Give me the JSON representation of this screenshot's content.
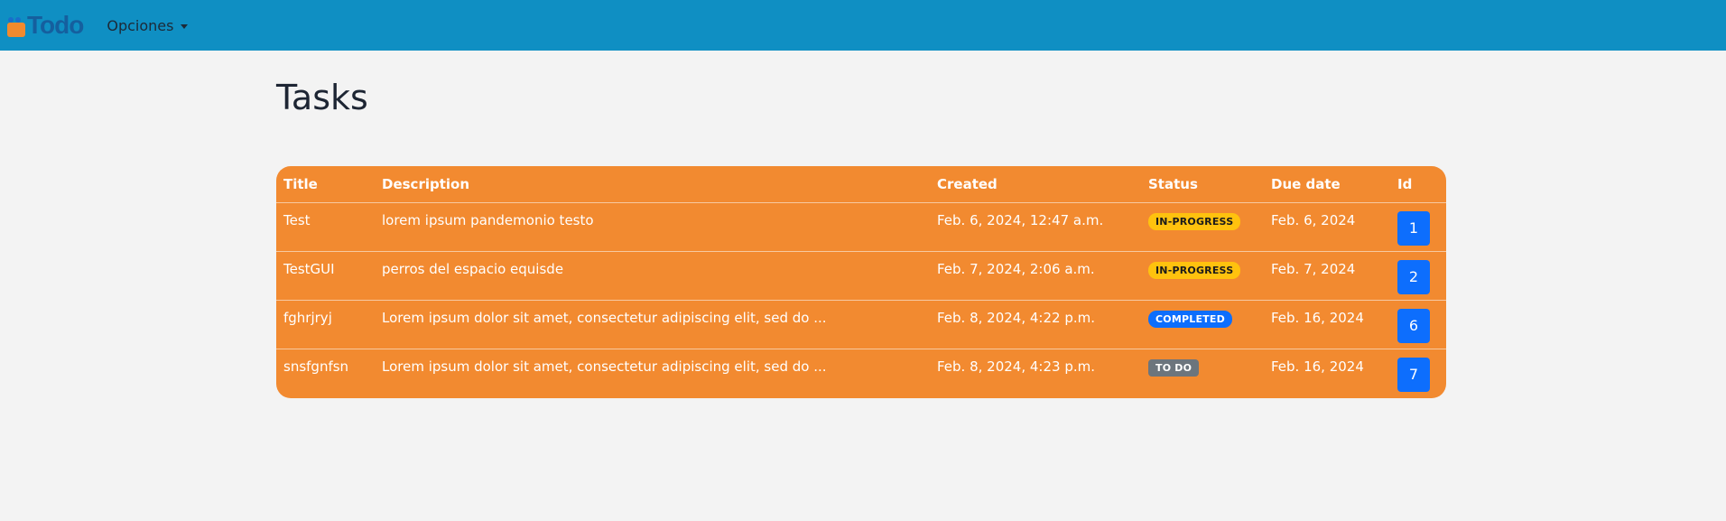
{
  "nav": {
    "brand": "Todo",
    "menu_label": "Opciones"
  },
  "page": {
    "title": "Tasks"
  },
  "table": {
    "headers": {
      "title": "Title",
      "description": "Description",
      "created": "Created",
      "status": "Status",
      "due_date": "Due date",
      "id": "Id"
    },
    "rows": [
      {
        "title": "Test",
        "description": "lorem ipsum pandemonio testo",
        "created": "Feb. 6, 2024, 12:47 a.m.",
        "status": "IN-PROGRESS",
        "due_date": "Feb. 6, 2024",
        "id": "1"
      },
      {
        "title": "TestGUI",
        "description": "perros del espacio equisde",
        "created": "Feb. 7, 2024, 2:06 a.m.",
        "status": "IN-PROGRESS",
        "due_date": "Feb. 7, 2024",
        "id": "2"
      },
      {
        "title": "fghrjryj",
        "description": "Lorem ipsum dolor sit amet, consectetur adipiscing elit, sed do ...",
        "created": "Feb. 8, 2024, 4:22 p.m.",
        "status": "COMPLETED",
        "due_date": "Feb. 16, 2024",
        "id": "6"
      },
      {
        "title": "snsfgnfsn",
        "description": "Lorem ipsum dolor sit amet, consectetur adipiscing elit, sed do ...",
        "created": "Feb. 8, 2024, 4:23 p.m.",
        "status": "TO DO",
        "due_date": "Feb. 16, 2024",
        "id": "7"
      }
    ]
  },
  "colors": {
    "navbar": "#0f8fc3",
    "table_bg": "#f28a30",
    "badge_in_progress": "#ffc20e",
    "badge_completed": "#0d6efd",
    "badge_todo": "#6c757d",
    "id_button": "#0d6efd"
  },
  "icons": {
    "brand": "todo-logo-icon",
    "menu": "caret-down-icon"
  }
}
